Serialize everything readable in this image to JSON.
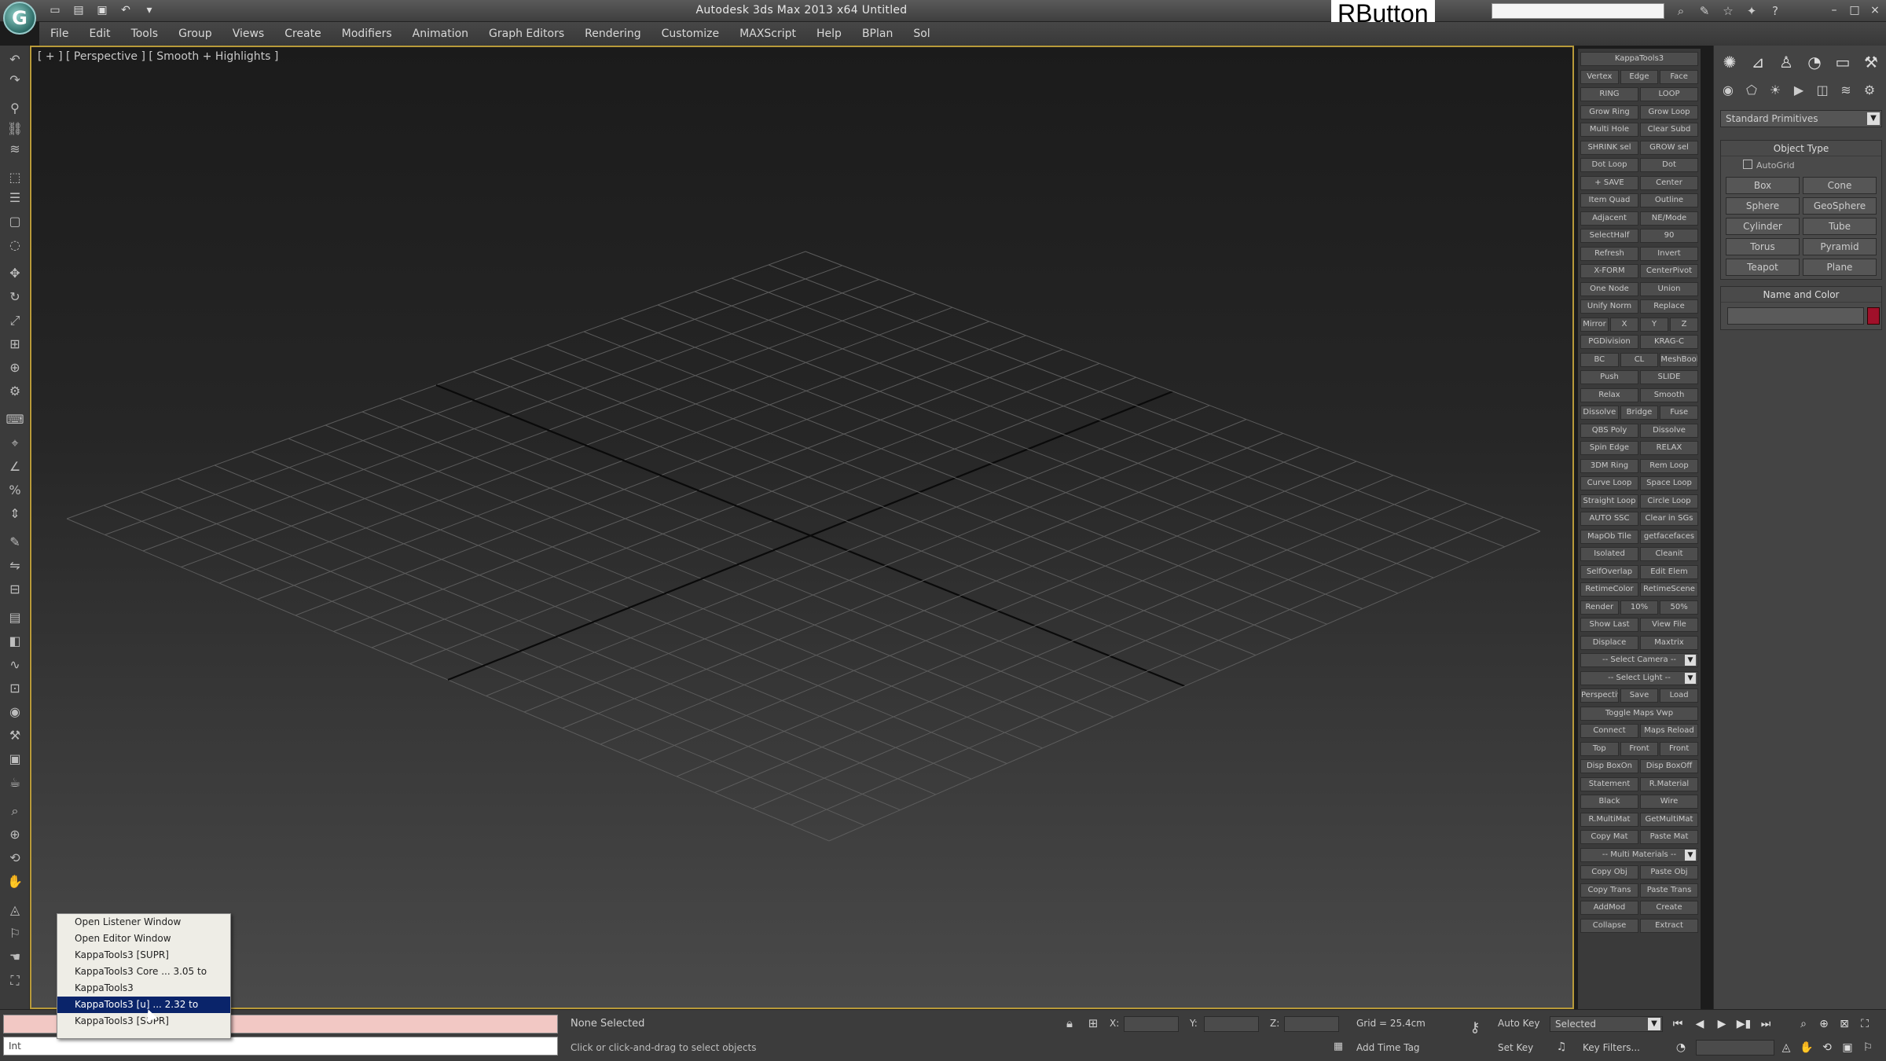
{
  "titlebar": {
    "logo": "G",
    "quick_access": [
      "new-icon",
      "open-icon",
      "save-icon",
      "undo-icon",
      "redo-icon"
    ],
    "title": "Autodesk 3ds Max 2013 x64    Untitled",
    "overlay_label": "RButton",
    "search_placeholder": "",
    "icons": [
      "binoculars-icon",
      "tool-icon",
      "star-icon",
      "bookmark-icon",
      "help-icon"
    ],
    "window_controls": [
      "minimize-icon",
      "maximize-icon",
      "close-icon"
    ]
  },
  "menu": [
    "File",
    "Edit",
    "Tools",
    "Group",
    "Views",
    "Create",
    "Modifiers",
    "Animation",
    "Graph Editors",
    "Rendering",
    "Customize",
    "MAXScript",
    "Help",
    "BPlan",
    "Sol"
  ],
  "viewport": {
    "label": "[ + ] [ Perspective ] [ Smooth + Highlights ]"
  },
  "command_panel": {
    "tabs": [
      "create-tab",
      "modify-tab",
      "hierarchy-tab",
      "motion-tab",
      "display-tab",
      "utilities-tab"
    ],
    "subtabs": [
      "geometry-icon",
      "shapes-icon",
      "lights-icon",
      "cameras-icon",
      "helpers-icon",
      "spacewarps-icon",
      "systems-icon"
    ],
    "primitive_type": "Standard Primitives",
    "object_type_header": "Object Type",
    "autogrid": "AutoGrid",
    "object_buttons": [
      "Box",
      "Cone",
      "Sphere",
      "GeoSphere",
      "Cylinder",
      "Tube",
      "Torus",
      "Pyramid",
      "Teapot",
      "Plane"
    ],
    "name_color_header": "Name and Color",
    "swatch_color": "#a0102a"
  },
  "kappa_tools": {
    "rows": [
      [
        "KappaTools3"
      ],
      [
        "Vertex",
        "Edge",
        "Face"
      ],
      [
        "RING",
        "LOOP"
      ],
      [
        "Grow Ring",
        "Grow Loop"
      ],
      [
        "Multi Hole",
        "Clear Subd"
      ],
      [
        "SHRINK sel",
        "GROW sel"
      ],
      [
        "Dot Loop",
        "Dot"
      ],
      [
        "+ SAVE",
        "Center"
      ],
      [
        "Item Quad",
        "Outline"
      ],
      [
        "Adjacent",
        "NE/Mode"
      ],
      [
        "SelectHalf",
        "90"
      ],
      [
        "Refresh",
        "Invert"
      ],
      [
        "X-FORM",
        "CenterPivot"
      ],
      [
        "One Node",
        "Union"
      ],
      [
        "Unify Norm",
        "Replace"
      ],
      [
        "Mirror",
        "X",
        "Y",
        "Z"
      ],
      [
        "PGDivision",
        "KRAG-C"
      ],
      [
        "BC",
        "CL",
        "MeshBoolN"
      ],
      [
        "Push",
        "SLIDE"
      ],
      [
        "Relax",
        "Smooth"
      ],
      [
        "Dissolve",
        "Bridge",
        "Fuse"
      ],
      [
        "QBS Poly",
        "Dissolve"
      ],
      [
        "Spin Edge",
        "RELAX"
      ],
      [
        "3DM Ring",
        "Rem Loop"
      ],
      [
        "Curve Loop",
        "Space Loop"
      ],
      [
        "Straight Loop",
        "Circle Loop"
      ],
      [
        "AUTO SSC",
        "Clear in SGs"
      ],
      [
        "MapOb Tile",
        "getfacefaces"
      ],
      [
        "Isolated",
        "Cleanit"
      ],
      [
        "SelfOverlap",
        "Edit Elem"
      ],
      [
        "RetimeColor",
        "RetimeScene"
      ],
      [
        "Render",
        "10%",
        "50%"
      ],
      [
        "Show Last",
        "View File"
      ],
      [
        "Displace",
        "Maxtrix"
      ],
      [
        "-- Select Camera --"
      ],
      [
        "-- Select Light --"
      ],
      [
        "Perspective",
        "Save",
        "Load"
      ],
      [
        "Toggle Maps Vwp"
      ],
      [
        "Connect",
        "Maps Reload"
      ],
      [
        "Top",
        "Front",
        "Front"
      ],
      [
        "Disp BoxOn",
        "Disp BoxOff"
      ],
      [
        "Statement",
        "R.Material"
      ],
      [
        "Black",
        "Wire"
      ],
      [
        "R.MultiMat",
        "GetMultiMat"
      ],
      [
        "Copy Mat",
        "Paste Mat"
      ],
      [
        "-- Multi Materials --"
      ],
      [
        "Copy Obj",
        "Paste Obj"
      ],
      [
        "Copy Trans",
        "Paste Trans"
      ],
      [
        "AddMod",
        "Create"
      ],
      [
        "Collapse",
        "Extract"
      ]
    ]
  },
  "status": {
    "selection": "None Selected",
    "prompt": "Click or click-and-drag to select objects",
    "x_label": "X:",
    "y_label": "Y:",
    "z_label": "Z:",
    "grid": "Grid = 25.4cm",
    "add_time_tag": "Add Time Tag",
    "auto_key": "Auto Key",
    "set_key": "Set Key",
    "selected": "Selected",
    "key_filters": "Key Filters...",
    "listener_text": "Int"
  },
  "context_menu": {
    "items": [
      "Open Listener Window",
      "Open Editor Window",
      "KappaTools3 [SUPR]",
      "KappaTools3 Core ... 3.05 to",
      "KappaTools3",
      "KappaTools3 [u] ... 2.32 to",
      "KappaTools3 [SUPR]"
    ],
    "active_index": 5
  }
}
